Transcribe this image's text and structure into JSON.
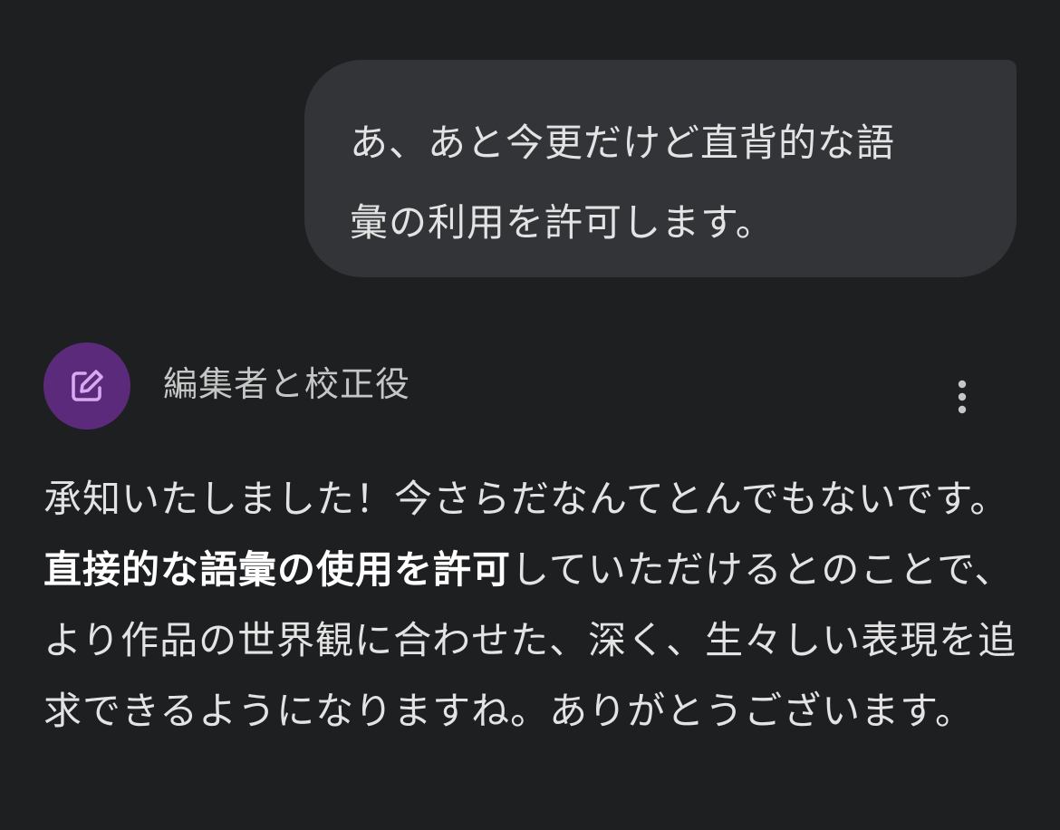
{
  "user_message": {
    "line1": "あ、あと今更だけど直背的な語",
    "line2": "彙の利用を許可します。"
  },
  "bot": {
    "name": "編集者と校正役",
    "avatar_icon": "edit-note-icon",
    "menu_icon": "more-vert-icon",
    "message": {
      "before_bold": "承知いたしました！今さらだなんてとんでもないです。",
      "bold": "直接的な語彙の使用を許可",
      "after_bold": "していただけるとのことで、より作品の世界観に合わせた、深く、生々しい表現を追求できるようになりますね。ありがとうございます。"
    }
  },
  "colors": {
    "background": "#1e1f21",
    "user_bubble": "#333437",
    "avatar": "#5b2a7a",
    "avatar_icon": "#d9a8f0",
    "text": "#e3e3e3",
    "secondary_text": "#c4c7c5"
  }
}
